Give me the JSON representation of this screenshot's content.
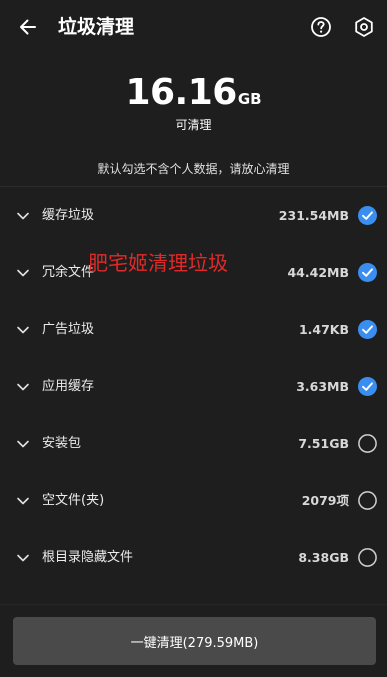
{
  "header": {
    "title": "垃圾清理",
    "back_icon": "arrow-left-icon",
    "help_icon": "help-circle-icon",
    "settings_icon": "gear-icon"
  },
  "summary": {
    "size_value": "16.16",
    "size_unit": "GB",
    "caption": "可清理",
    "hint": "默认勾选不含个人数据，请放心清理"
  },
  "items": [
    {
      "label": "缓存垃圾",
      "size": "231.54MB",
      "checked": true
    },
    {
      "label": "冗余文件",
      "size": "44.42MB",
      "checked": true
    },
    {
      "label": "广告垃圾",
      "size": "1.47KB",
      "checked": true
    },
    {
      "label": "应用缓存",
      "size": "3.63MB",
      "checked": true
    },
    {
      "label": "安装包",
      "size": "7.51GB",
      "checked": false
    },
    {
      "label": "空文件(夹)",
      "size": "2079项",
      "checked": false
    },
    {
      "label": "根目录隐藏文件",
      "size": "8.38GB",
      "checked": false
    }
  ],
  "watermark": "肥宅姬清理垃圾",
  "action": {
    "label": "一键清理(279.59MB)"
  },
  "colors": {
    "background": "#1e1e1e",
    "accent": "#3a8ef0",
    "watermark": "#e02a2a",
    "button": "#4a4a4a"
  }
}
